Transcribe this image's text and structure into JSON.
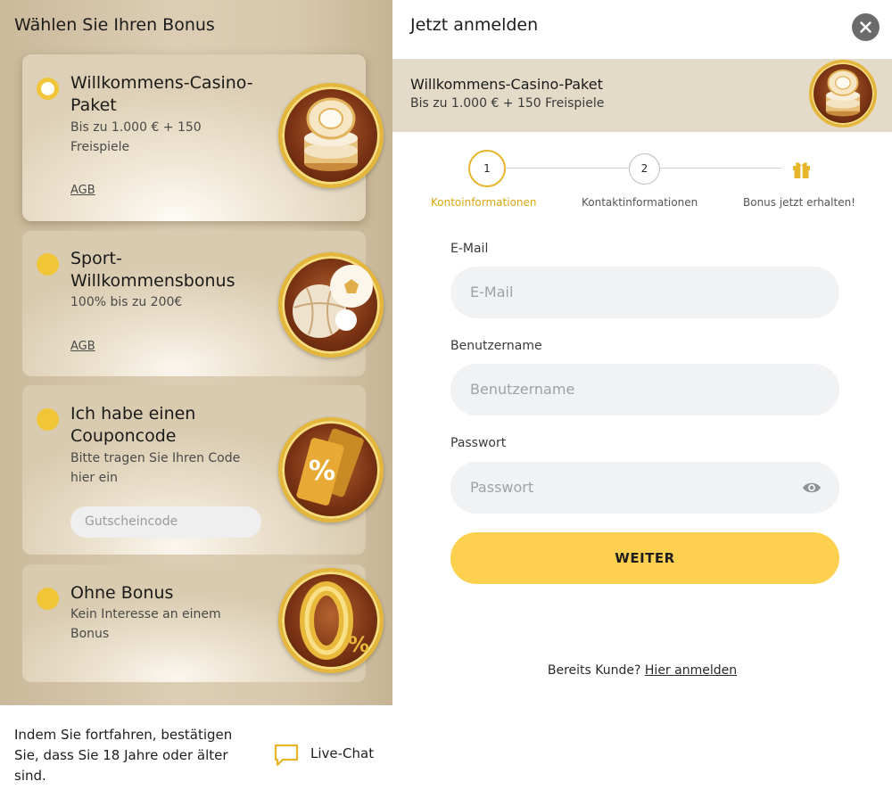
{
  "left": {
    "heading": "Wählen Sie Ihren Bonus",
    "cards": [
      {
        "title": "Willkommens-Casino-Paket",
        "subtitle": "Bis zu 1.000 € + 150 Freispiele",
        "link": "AGB",
        "selected": true,
        "icon": "casino-chips-icon"
      },
      {
        "title": "Sport-Willkommensbonus",
        "subtitle": "100% bis zu 200€",
        "link": "AGB",
        "selected": false,
        "icon": "sports-balls-icon"
      },
      {
        "title": "Ich habe einen Couponcode",
        "subtitle": "Bitte tragen Sie Ihren Code hier ein",
        "input_placeholder": "Gutscheincode",
        "selected": false,
        "icon": "coupon-ticket-icon"
      },
      {
        "title": "Ohne Bonus",
        "subtitle": "Kein Interesse an einem Bonus",
        "selected": false,
        "icon": "zero-percent-icon"
      }
    ],
    "footer": {
      "text": "Indem Sie fortfahren, bestätigen Sie, dass Sie 18 Jahre oder älter sind.",
      "chat_label": "Live-Chat"
    }
  },
  "right": {
    "heading": "Jetzt anmelden",
    "banner": {
      "title": "Willkommens-Casino-Paket",
      "subtitle": "Bis zu 1.000 € + 150 Freispiele"
    },
    "steps": [
      {
        "number": "1",
        "label": "Kontoinformationen",
        "active": true
      },
      {
        "number": "2",
        "label": "Kontaktinformationen",
        "active": false
      },
      {
        "number": "",
        "label": "Bonus jetzt erhalten!",
        "active": false
      }
    ],
    "form": {
      "email_label": "E-Mail",
      "email_placeholder": "E-Mail",
      "username_label": "Benutzername",
      "username_placeholder": "Benutzername",
      "password_label": "Passwort",
      "password_placeholder": "Passwort",
      "submit_label": "WEITER"
    },
    "login": {
      "prompt": "Bereits Kunde?",
      "link": "Hier anmelden"
    }
  },
  "colors": {
    "accent": "#fdd14f",
    "radio": "#f0c537",
    "active_step": "#d9a70f",
    "banner_bg": "#e4dac8",
    "field_bg": "#f1f2f4"
  }
}
